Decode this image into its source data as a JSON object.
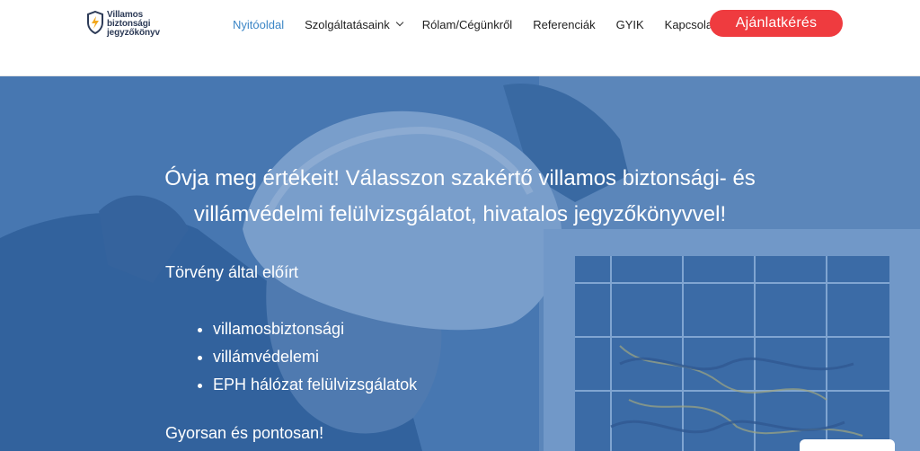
{
  "logo": {
    "line1": "Villamos",
    "line2": "biztonsági",
    "line3": "jegyzőkönyv"
  },
  "nav": {
    "items": [
      {
        "label": "Nyitóoldal",
        "active": true
      },
      {
        "label": "Szolgáltatásaink",
        "dropdown": true
      },
      {
        "label": "Rólam/Cégünkről"
      },
      {
        "label": "Referenciák"
      },
      {
        "label": "GYIK"
      },
      {
        "label": "Kapcsolat"
      }
    ],
    "cta": "Ajánlatkérés"
  },
  "hero": {
    "headline_line1": "Óvja meg értékeit! Válasszon szakértő villamos biztonsági- és",
    "headline_line2": "villámvédelmi felülvizsgálatot, hivatalos jegyzőkönyvvel!",
    "intro": "Törvény által előírt",
    "bullets": [
      "villamosbiztonsági",
      "villámvédelemi",
      "EPH hálózat felülvizsgálatok"
    ],
    "closing": "Gyorsan és pontosan!"
  },
  "colors": {
    "accent": "#3c86c6",
    "cta": "#ef3b3f",
    "hero_overlay": "#3a6caa"
  }
}
